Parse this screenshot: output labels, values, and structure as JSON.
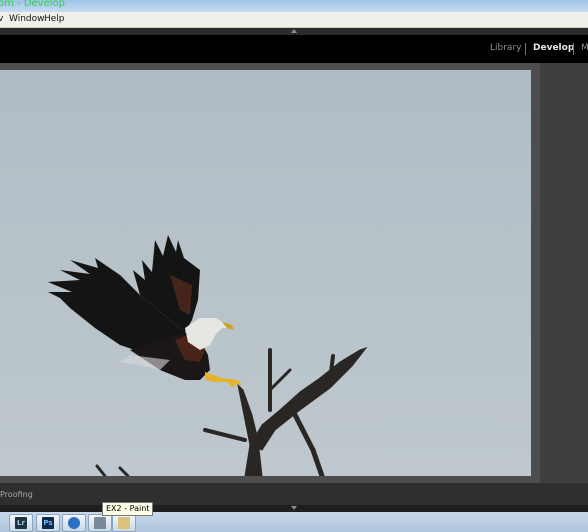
{
  "window": {
    "title_fragment": "om - Develop"
  },
  "menu": {
    "items": [
      "v",
      "Window",
      "Help"
    ]
  },
  "module_picker": {
    "modules": [
      "Library",
      "Develop",
      "M"
    ],
    "active": "Develop"
  },
  "photo": {
    "subject": "bird-on-branch-image"
  },
  "toolbar": {
    "label": "Proofing"
  },
  "taskbar": {
    "tooltip": "EX2 - Paint",
    "buttons": [
      {
        "icon": "lightroom-icon",
        "label": "Lr"
      },
      {
        "icon": "photoshop-icon",
        "label": "Ps"
      },
      {
        "icon": "browser-icon",
        "label": ""
      },
      {
        "icon": "tool-icon",
        "label": ""
      },
      {
        "icon": "paint-icon",
        "label": ""
      }
    ]
  },
  "colors": {
    "accent_green": "#2fd24a",
    "module_active": "#e6e6e6",
    "module_inactive": "#8e8e8e",
    "sky": "#b7c2c9"
  }
}
